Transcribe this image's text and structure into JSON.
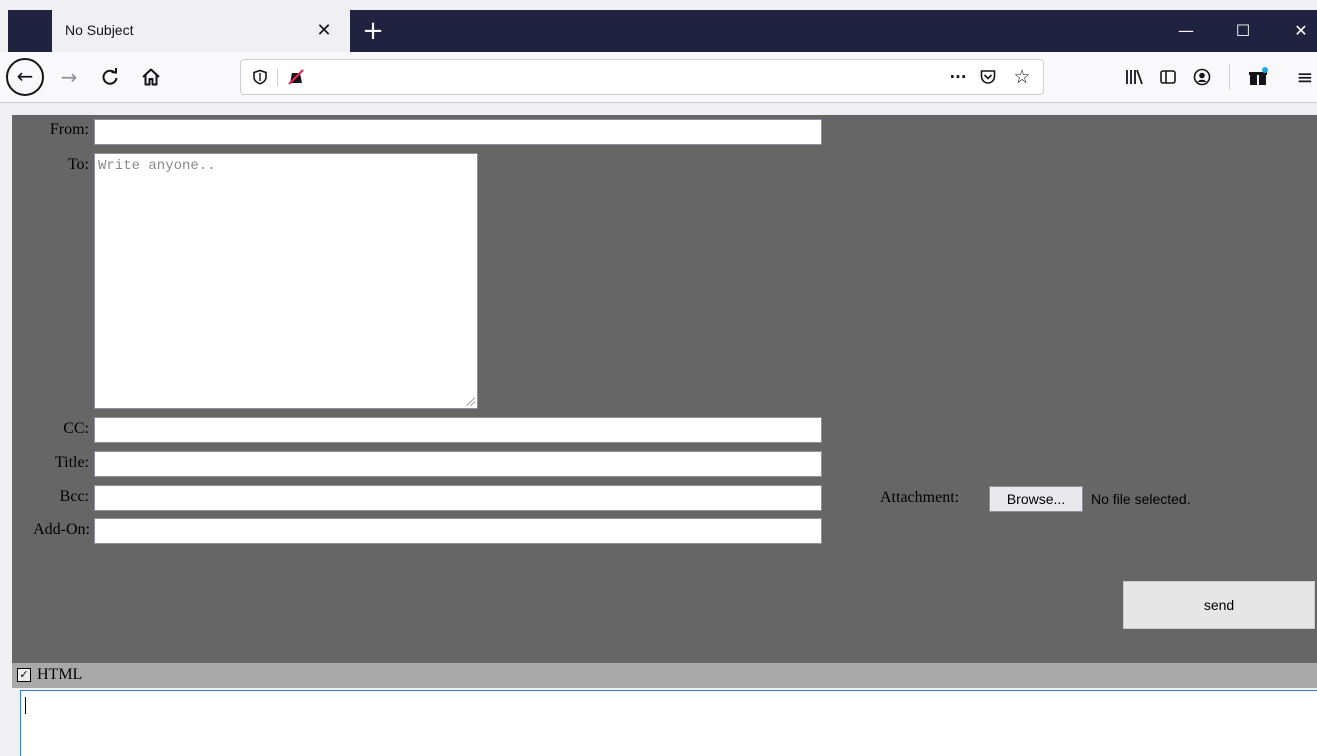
{
  "browser": {
    "tab_title": "No Subject",
    "tab_close_icon": "close-icon",
    "new_tab_icon": "plus-icon",
    "window_controls": {
      "minimize": "—",
      "maximize": "☐",
      "close": "✕"
    },
    "nav": {
      "back": "←",
      "forward": "→",
      "reload": "C",
      "home": "⌂"
    },
    "url": "",
    "url_icons": [
      "shield-icon",
      "tracking-blocked-icon"
    ],
    "url_actions": [
      "more-icon",
      "pocket-icon",
      "bookmark-star-icon"
    ],
    "toolbar_icons": [
      "library-icon",
      "sidebar-icon",
      "account-icon",
      "extensions-icon",
      "menu-icon"
    ]
  },
  "form": {
    "from_label": "From:",
    "from_value": "",
    "to_label": "To:",
    "to_placeholder": "Write anyone..",
    "cc_label": "CC:",
    "cc_value": "",
    "title_label": "Title:",
    "title_value": "",
    "bcc_label": "Bcc:",
    "bcc_value": "",
    "addon_label": "Add-On:",
    "addon_value": "",
    "attachment_label": "Attachment:",
    "browse_label": "Browse...",
    "no_file_text": "No file selected.",
    "send_label": "send"
  },
  "html_toggle": {
    "checked": true,
    "label": "HTML"
  },
  "editor": {
    "value": ""
  }
}
